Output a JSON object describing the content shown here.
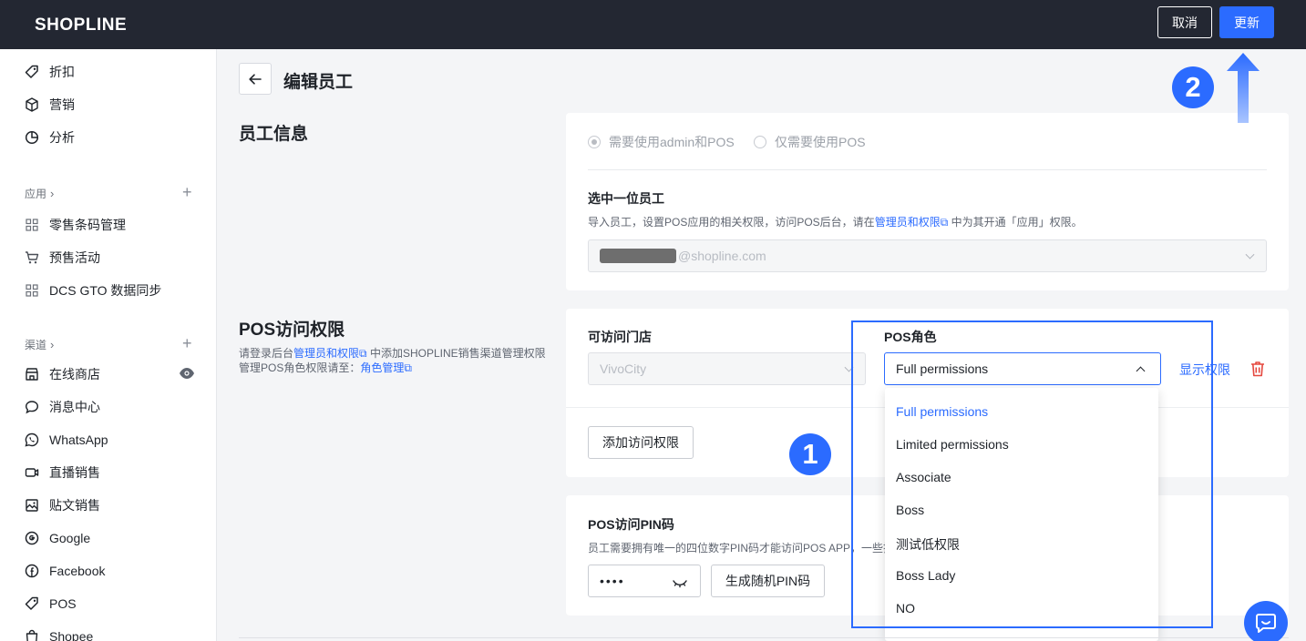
{
  "topbar": {
    "logo": "SHOPLINE",
    "cancel_label": "取消",
    "update_label": "更新"
  },
  "sidebar": {
    "top_items": [
      {
        "label": "折扣",
        "icon": "tag-icon"
      },
      {
        "label": "营销",
        "icon": "cube-icon"
      },
      {
        "label": "分析",
        "icon": "pie-chart-icon"
      }
    ],
    "apps_label": "应用",
    "apps_items": [
      {
        "label": "零售条码管理",
        "icon": "app-grid-icon"
      },
      {
        "label": "预售活动",
        "icon": "presale-cart-icon"
      },
      {
        "label": "DCS GTO 数据同步",
        "icon": "app-grid-icon"
      }
    ],
    "channels_label": "渠道",
    "channel_items": [
      {
        "label": "在线商店",
        "icon": "store-icon"
      },
      {
        "label": "消息中心",
        "icon": "message-icon"
      },
      {
        "label": "WhatsApp",
        "icon": "whatsapp-icon"
      },
      {
        "label": "直播销售",
        "icon": "live-video-icon"
      },
      {
        "label": "贴文销售",
        "icon": "image-post-icon"
      },
      {
        "label": "Google",
        "icon": "google-icon"
      },
      {
        "label": "Facebook",
        "icon": "facebook-icon"
      },
      {
        "label": "POS",
        "icon": "pos-tag-icon"
      },
      {
        "label": "Shopee",
        "icon": "shopee-bag-icon"
      }
    ]
  },
  "page": {
    "title": "编辑员工"
  },
  "employee_info": {
    "section_title": "员工信息",
    "radio_admin_pos": "需要使用admin和POS",
    "radio_pos_only": "仅需要使用POS",
    "select_label": "选中一位员工",
    "hint_prefix": "导入员工，设置POS应用的相关权限，访问POS后台，请在",
    "hint_link": "管理员和权限",
    "hint_suffix": " 中为其开通「应用」权限。",
    "email_suffix": "@shopline.com"
  },
  "pos_access": {
    "section_title": "POS访问权限",
    "desc_prefix": "请登录后台",
    "desc_link1": "管理员和权限",
    "desc_mid": " 中添加SHOPLINE销售渠道管理权限",
    "desc_line2_prefix": "管理POS角色权限请至：",
    "desc_link2": "角色管理",
    "store_label": "可访问门店",
    "store_value": "VivoCity",
    "role_label": "POS角色",
    "role_value": "Full permissions",
    "show_permissions": "显示权限",
    "add_access_label": "添加访问权限"
  },
  "pin": {
    "title": "POS访问PIN码",
    "hint": "员工需要拥有唯一的四位数字PIN码才能访问POS APP，一些操",
    "masked_value": "••••",
    "generate_label": "生成随机PIN码"
  },
  "role_menu": {
    "options": [
      "Full permissions",
      "Limited permissions",
      "Associate",
      "Boss",
      "测试低权限",
      "Boss Lady",
      "NO"
    ],
    "selected": "Full permissions"
  },
  "annotations": {
    "badge1": "1",
    "badge2": "2"
  },
  "colors": {
    "accent": "#2b6bff",
    "topbar": "#232732",
    "danger": "#e5483f"
  }
}
